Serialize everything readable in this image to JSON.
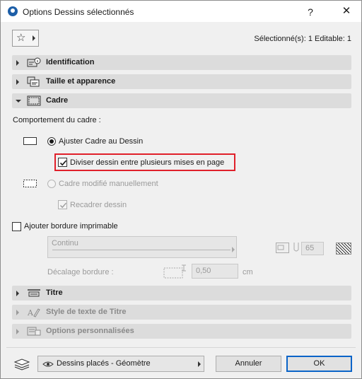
{
  "window": {
    "title": "Options Dessins sélectionnés",
    "help_label": "?",
    "close_label": "✕"
  },
  "header": {
    "favorites_icon": "star-icon",
    "selection_info": "Sélectionné(s): 1 Editable: 1"
  },
  "panels": {
    "identification": "Identification",
    "taille": "Taille et apparence",
    "cadre": "Cadre",
    "titre": "Titre",
    "style_titre": "Style de texte de Titre",
    "options_perso": "Options personnalisées"
  },
  "cadre": {
    "comportement_label": "Comportement du cadre :",
    "ajuster_label": "Ajuster Cadre au Dessin",
    "ajuster_selected": true,
    "diviser_label": "Diviser dessin entre plusieurs mises en page",
    "diviser_checked": true,
    "manuel_label": "Cadre modifié manuellement",
    "recadrer_label": "Recadrer dessin",
    "recadrer_checked": true
  },
  "bordure": {
    "ajouter_label": "Ajouter bordure imprimable",
    "ajouter_checked": false,
    "linetype_value": "Continu",
    "pen_value": "65",
    "decalage_label": "Décalage bordure :",
    "decalage_value": "0,50",
    "decalage_unit": "cm"
  },
  "footer": {
    "layer_value": "Dessins placés - Géomètre",
    "cancel_label": "Annuler",
    "ok_label": "OK"
  },
  "colors": {
    "highlight": "#e0202a",
    "ok_border": "#0a64c8",
    "panel_bg": "#dcdcdc"
  }
}
